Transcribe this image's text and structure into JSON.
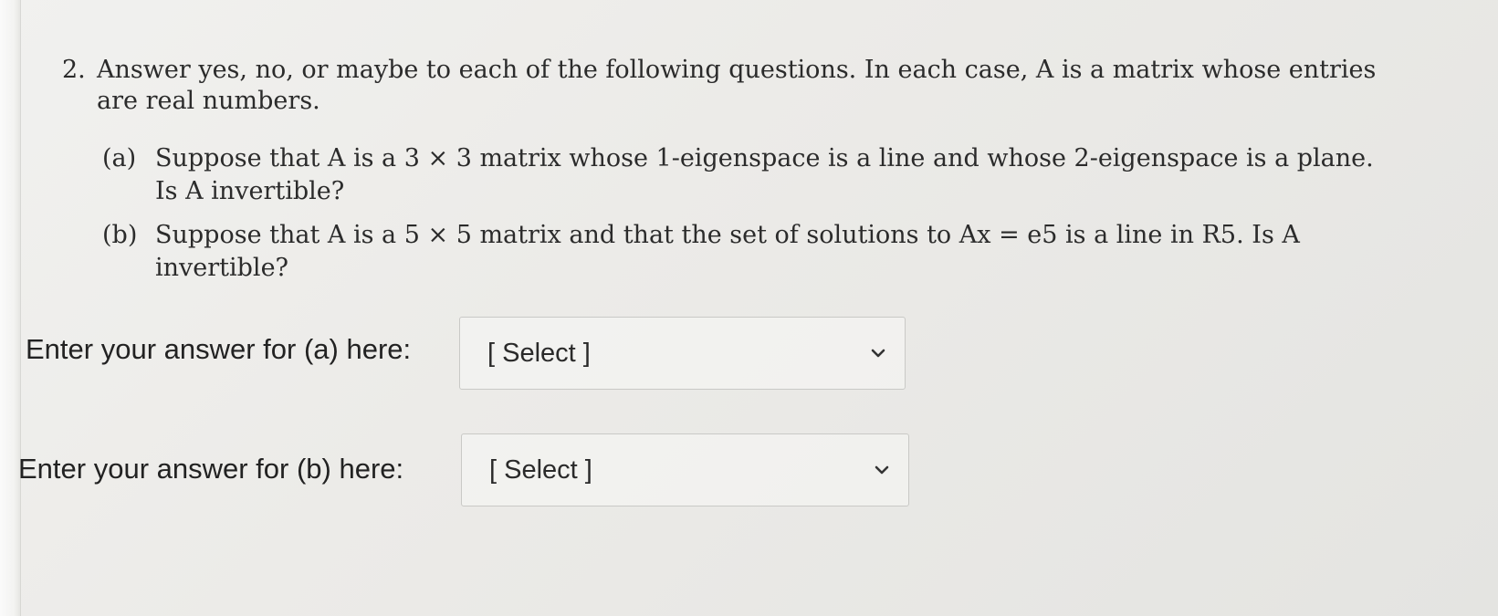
{
  "question": {
    "number": "2.",
    "line1": "Answer yes, no, or maybe to each of the following questions. In each case, A is a matrix whose entries",
    "line2": "are real numbers."
  },
  "part_a": {
    "label": "(a)",
    "line1": "Suppose that A is a 3 × 3 matrix whose 1-eigenspace is a line and whose 2-eigenspace is a plane.",
    "line2": "Is A invertible?"
  },
  "part_b": {
    "label": "(b)",
    "line1": "Suppose that A is a 5 × 5 matrix and that the set of solutions to Ax = e5 is a line in R5. Is A",
    "line2": "invertible?"
  },
  "answers": {
    "a_label": "Enter your answer for (a) here:",
    "a_selected": "[ Select ]",
    "b_label": "Enter your answer for (b) here:",
    "b_selected": "[ Select ]"
  },
  "icons": {
    "dropdown": "chevron-down-icon"
  }
}
